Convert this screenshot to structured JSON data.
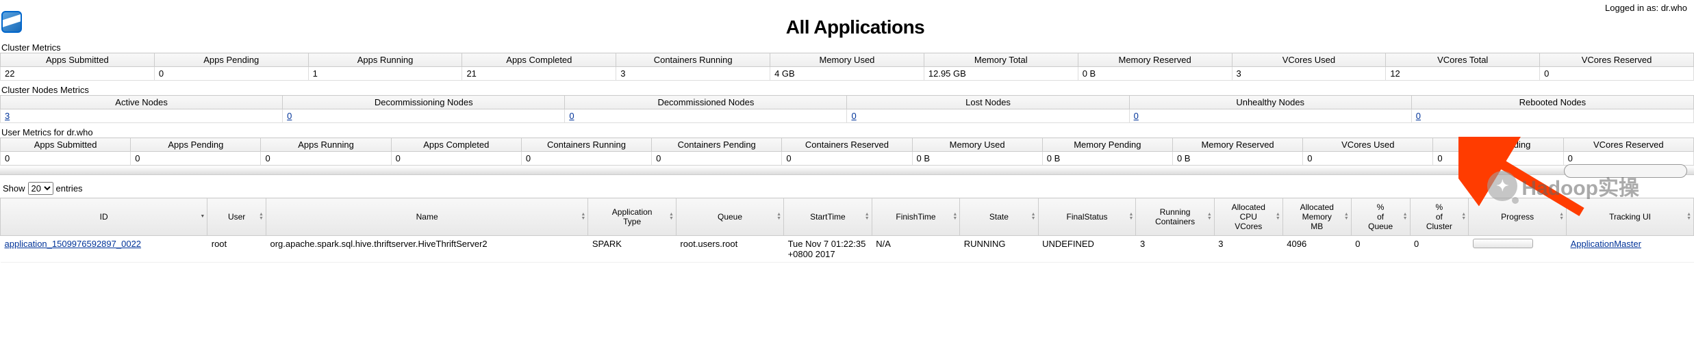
{
  "header": {
    "title": "All Applications",
    "login_prefix": "Logged in as: ",
    "login_user": "dr.who"
  },
  "sections": {
    "cluster_metrics_label": "Cluster Metrics",
    "cluster_nodes_label": "Cluster Nodes Metrics",
    "user_metrics_label": "User Metrics for dr.who"
  },
  "cluster_metrics": {
    "headers": [
      "Apps Submitted",
      "Apps Pending",
      "Apps Running",
      "Apps Completed",
      "Containers Running",
      "Memory Used",
      "Memory Total",
      "Memory Reserved",
      "VCores Used",
      "VCores Total",
      "VCores Reserved"
    ],
    "values": [
      "22",
      "0",
      "1",
      "21",
      "3",
      "4 GB",
      "12.95 GB",
      "0 B",
      "3",
      "12",
      "0"
    ]
  },
  "cluster_nodes": {
    "headers": [
      "Active Nodes",
      "Decommissioning Nodes",
      "Decommissioned Nodes",
      "Lost Nodes",
      "Unhealthy Nodes",
      "Rebooted Nodes"
    ],
    "values": [
      "3",
      "0",
      "0",
      "0",
      "0",
      "0"
    ]
  },
  "user_metrics": {
    "headers": [
      "Apps Submitted",
      "Apps Pending",
      "Apps Running",
      "Apps Completed",
      "Containers Running",
      "Containers Pending",
      "Containers Reserved",
      "Memory Used",
      "Memory Pending",
      "Memory Reserved",
      "VCores Used",
      "VCores Pending",
      "VCores Reserved"
    ],
    "values": [
      "0",
      "0",
      "0",
      "0",
      "0",
      "0",
      "0",
      "0 B",
      "0 B",
      "0 B",
      "0",
      "0",
      "0"
    ]
  },
  "controls": {
    "show_label": "Show",
    "page_size": "20",
    "entries_label": "entries"
  },
  "app_table": {
    "headers": [
      "ID",
      "User",
      "Name",
      "Application Type",
      "Queue",
      "StartTime",
      "FinishTime",
      "State",
      "FinalStatus",
      "Running Containers",
      "Allocated CPU VCores",
      "Allocated Memory MB",
      "% of Queue",
      "% of Cluster",
      "Progress",
      "Tracking UI"
    ],
    "row": {
      "id": "application_1509976592897_0022",
      "user": "root",
      "name": "org.apache.spark.sql.hive.thriftserver.HiveThriftServer2",
      "apptype": "SPARK",
      "queue": "root.users.root",
      "starttime": "Tue Nov 7 01:22:35 +0800 2017",
      "finishtime": "N/A",
      "state": "RUNNING",
      "finalstatus": "UNDEFINED",
      "running_containers": "3",
      "cpu_vcores": "3",
      "memory_mb": "4096",
      "pct_queue": "0",
      "pct_cluster": "0",
      "tracking": "ApplicationMaster"
    }
  },
  "watermark": {
    "text": "Hadoop实操"
  }
}
